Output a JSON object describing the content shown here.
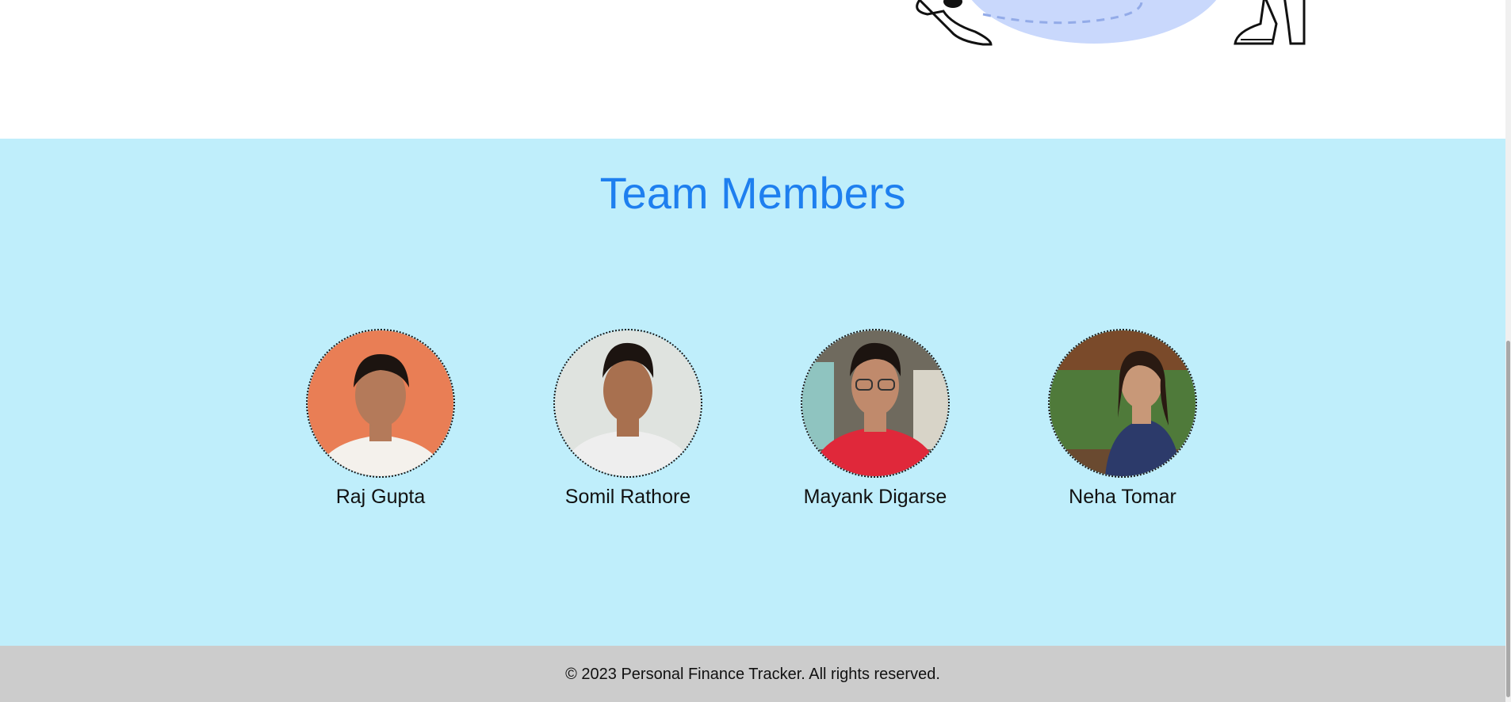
{
  "team": {
    "title": "Team Members",
    "members": [
      {
        "name": "Raj Gupta",
        "bg": "#e97e55",
        "shirt": "#f4f1ec",
        "skin": "#b47a5a",
        "hair": "#1c1410"
      },
      {
        "name": "Somil Rathore",
        "bg": "#dfe3df",
        "shirt": "#eeeeee",
        "skin": "#a8704f",
        "hair": "#1c1410"
      },
      {
        "name": "Mayank Digarse",
        "bg": "#6f6a5e",
        "shirt": "#e0283a",
        "skin": "#c08a6c",
        "hair": "#1c1410"
      },
      {
        "name": "Neha Tomar",
        "bg": "#4f7a3a",
        "shirt": "#2c3a6a",
        "skin": "#c89878",
        "hair": "#2a1a12"
      }
    ]
  },
  "footer": {
    "text": "© 2023 Personal Finance Tracker. All rights reserved."
  },
  "colors": {
    "team_bg": "#bfeefb",
    "title": "#1e7fef",
    "footer_bg": "#cccccc"
  }
}
